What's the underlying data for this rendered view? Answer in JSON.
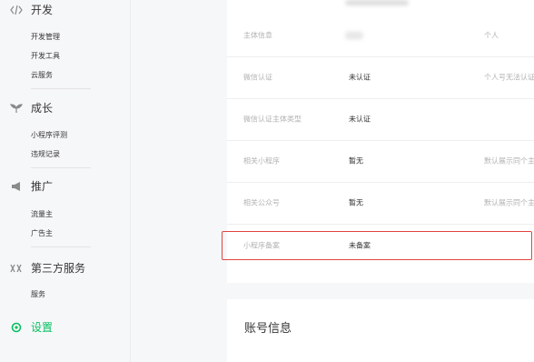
{
  "sidebar": {
    "sections": [
      {
        "title": "开发",
        "icon": "code-icon",
        "items": [
          "开发管理",
          "开发工具",
          "云服务"
        ]
      },
      {
        "title": "成长",
        "icon": "sprout-icon",
        "items": [
          "小程序评测",
          "违规记录"
        ]
      },
      {
        "title": "推广",
        "icon": "megaphone-icon",
        "items": [
          "流量主",
          "广告主"
        ]
      },
      {
        "title": "第三方服务",
        "icon": "puzzle-icon",
        "items": [
          "服务"
        ]
      },
      {
        "title": "设置",
        "icon": "settings-icon",
        "items": [],
        "active": true
      }
    ]
  },
  "basic_info": {
    "rows": [
      {
        "label": "主体信息",
        "value": "",
        "right": "个人"
      },
      {
        "label": "微信认证",
        "value": "未认证",
        "right": "个人号无法认证"
      },
      {
        "label": "微信认证主体类型",
        "value": "未认证",
        "right": ""
      },
      {
        "label": "相关小程序",
        "value": "暂无",
        "right": "默认展示同个主体"
      },
      {
        "label": "相关公众号",
        "value": "暂无",
        "right": "默认展示同个主体"
      },
      {
        "label": "小程序备案",
        "value": "未备案",
        "right": ""
      }
    ]
  },
  "account_info": {
    "title": "账号信息"
  },
  "colors": {
    "accent": "#07c160",
    "highlight_border": "#e0443e"
  }
}
